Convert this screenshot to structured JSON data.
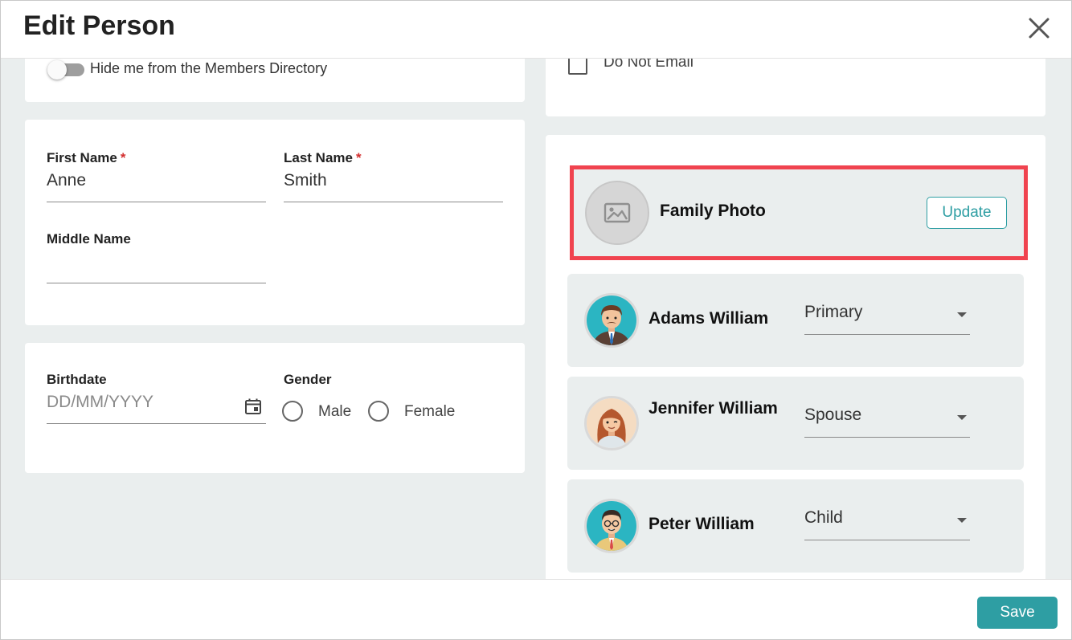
{
  "dialog": {
    "title": "Edit Person",
    "save_label": "Save"
  },
  "privacy": {
    "hide_label": "Hide me from the Members Directory",
    "hide_enabled": false
  },
  "contact": {
    "do_not_email_label": "Do Not Email",
    "do_not_email_checked": false
  },
  "name": {
    "first_label": "First Name",
    "first_value": "Anne",
    "last_label": "Last Name",
    "last_value": "Smith",
    "middle_label": "Middle Name",
    "middle_value": "",
    "required_mark": "*"
  },
  "details": {
    "birthdate_label": "Birthdate",
    "birthdate_placeholder": "DD/MM/YYYY",
    "gender_label": "Gender",
    "gender_options": [
      "Male",
      "Female"
    ]
  },
  "family": {
    "photo_title": "Family Photo",
    "update_label": "Update",
    "members": [
      {
        "name": "Adams William",
        "role": "Primary"
      },
      {
        "name": "Jennifer William",
        "role": "Spouse"
      },
      {
        "name": "Peter William",
        "role": "Child"
      }
    ]
  },
  "colors": {
    "accent": "#2e9ea3",
    "highlight": "#f0434f",
    "background": "#eaeeee",
    "required": "#d32f2f"
  }
}
